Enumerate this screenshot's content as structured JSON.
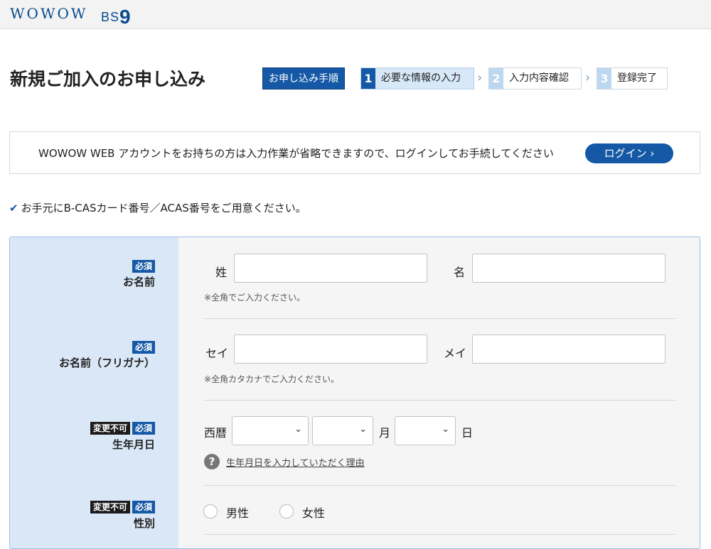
{
  "header": {
    "logo_wowow": "WOWOW",
    "logo_bs": "BS",
    "logo_nine": "9"
  },
  "page": {
    "title": "新規ご加入のお申し込み"
  },
  "steps": {
    "procedure_label": "お申し込み手順",
    "items": [
      {
        "num": "1",
        "label": "必要な情報の入力"
      },
      {
        "num": "2",
        "label": "入力内容確認"
      },
      {
        "num": "3",
        "label": "登録完了"
      }
    ],
    "arrow": "›"
  },
  "login_bar": {
    "message": "WOWOW WEB アカウントをお持ちの方は入力作業が省略できますので、ログインしてお手続してください",
    "button_label": "ログイン ›"
  },
  "notice": {
    "check": "✔",
    "text": "お手元にB-CASカード番号／ACAS番号をご用意ください。"
  },
  "badges": {
    "required": "必須",
    "locked": "変更不可"
  },
  "form": {
    "name": {
      "label": "お名前",
      "last_label": "姓",
      "first_label": "名",
      "last_value": "",
      "first_value": "",
      "note": "※全角でご入力ください。"
    },
    "kana": {
      "label": "お名前（フリガナ）",
      "last_label": "セイ",
      "first_label": "メイ",
      "last_value": "",
      "first_value": "",
      "note": "※全角カタカナでご入力ください。"
    },
    "birth": {
      "label": "生年月日",
      "era_label": "西暦",
      "month_label": "月",
      "day_label": "日",
      "year_value": "",
      "month_value": "",
      "day_value": "",
      "help_icon": "?",
      "help_link": "生年月日を入力していただく理由"
    },
    "gender": {
      "label": "性別",
      "male": "男性",
      "female": "女性"
    }
  },
  "colors": {
    "brand_blue": "#1458a6",
    "label_col": "#d9e7f6"
  }
}
